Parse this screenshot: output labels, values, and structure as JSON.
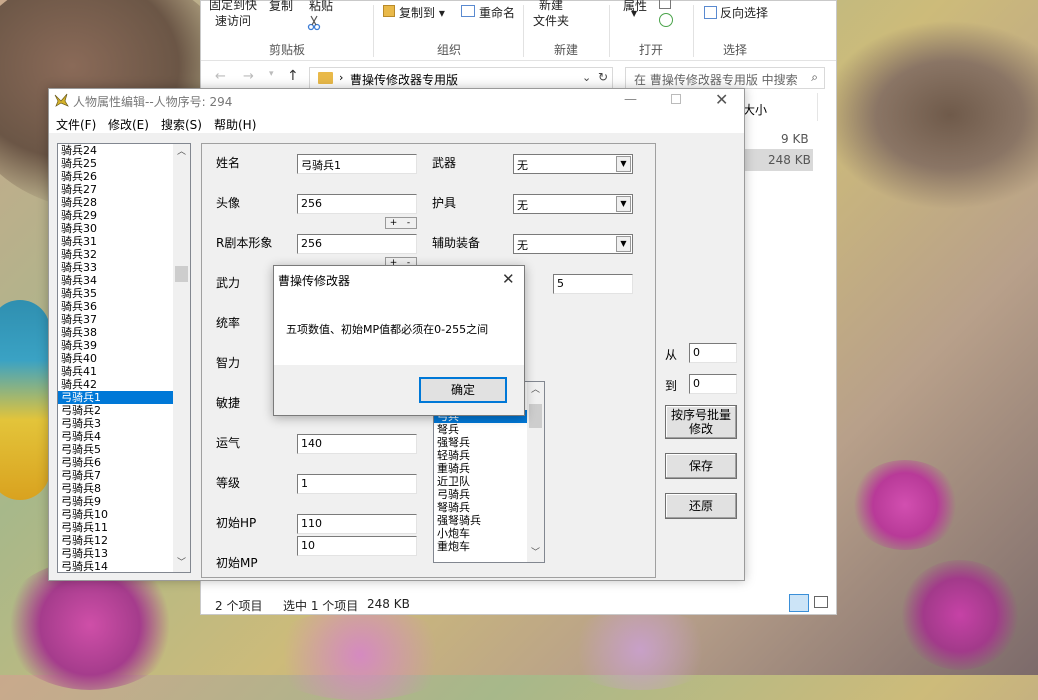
{
  "desktop": {},
  "explorer": {
    "ribbon": {
      "pin_quick_access": "固定到快\n速访问",
      "copy": "复制",
      "paste": "粘贴",
      "copy_to": "复制到",
      "rename": "重命名",
      "new_folder": "新建\n文件夹",
      "properties": "属性",
      "invert_selection": "反向选择",
      "group_clipboard": "剪贴板",
      "group_organize": "组织",
      "group_new": "新建",
      "group_open": "打开",
      "group_select": "选择"
    },
    "address": {
      "path": "曹操传修改器专用版",
      "search_placeholder": "在 曹操传修改器专用版 中搜索"
    },
    "columns": {
      "size": "大小"
    },
    "sizes": [
      "9 KB",
      "248 KB"
    ],
    "status": {
      "item_count": "2 个项目",
      "selected": "选中 1 个项目",
      "selected_size": "248 KB"
    }
  },
  "editor": {
    "title": "人物属性编辑--人物序号: 294",
    "menu": [
      "文件(F)",
      "修改(E)",
      "搜索(S)",
      "帮助(H)"
    ],
    "unit_list": [
      "骑兵24",
      "骑兵25",
      "骑兵26",
      "骑兵27",
      "骑兵28",
      "骑兵29",
      "骑兵30",
      "骑兵31",
      "骑兵32",
      "骑兵33",
      "骑兵34",
      "骑兵35",
      "骑兵36",
      "骑兵37",
      "骑兵38",
      "骑兵39",
      "骑兵40",
      "骑兵41",
      "骑兵42",
      "弓骑兵1",
      "弓骑兵2",
      "弓骑兵3",
      "弓骑兵4",
      "弓骑兵5",
      "弓骑兵6",
      "弓骑兵7",
      "弓骑兵8",
      "弓骑兵9",
      "弓骑兵10",
      "弓骑兵11",
      "弓骑兵12",
      "弓骑兵13",
      "弓骑兵14"
    ],
    "selected_unit_index": 19,
    "fields": {
      "name_label": "姓名",
      "name_value": "弓骑兵1",
      "portrait_label": "头像",
      "portrait_value": "256",
      "rmodel_label": "R剧本形象",
      "rmodel_value": "256",
      "force_label": "武力",
      "command_label": "统率",
      "intel_label": "智力",
      "agility_label": "敏捷",
      "luck_label": "运气",
      "luck_value": "140",
      "level_label": "等级",
      "level_value": "1",
      "hp_label": "初始HP",
      "hp_value": "110",
      "mp_label": "初始MP",
      "mp_value": "10",
      "weapon_label": "武器",
      "weapon_value": "无",
      "armor_label": "护具",
      "armor_value": "无",
      "aux_label": "辅助装备",
      "aux_value": "无",
      "extra_value": "5",
      "spin_plus": "+",
      "spin_minus": "-"
    },
    "job_list": [
      "弓兵",
      "弩兵",
      "强弩兵",
      "轻骑兵",
      "重骑兵",
      "近卫队",
      "弓骑兵",
      "弩骑兵",
      "强弩骑兵",
      "小炮车",
      "重炮车"
    ],
    "selected_job_index": 0,
    "range": {
      "from_label": "从",
      "from_value": "0",
      "to_label": "到",
      "to_value": "0"
    },
    "buttons": {
      "batch": "按序号批量\n修改",
      "save": "保存",
      "restore": "还原"
    }
  },
  "msgbox": {
    "title": "曹操传修改器",
    "message": "五项数值、初始MP值都必须在0-255之间",
    "ok": "确定"
  }
}
